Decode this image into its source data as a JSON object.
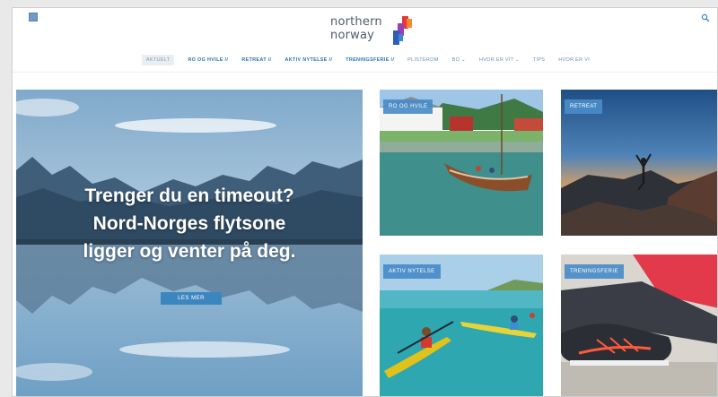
{
  "header": {
    "logo_line1": "northern",
    "logo_line2": "norway"
  },
  "nav": {
    "items": [
      {
        "label": "AKTUELT",
        "style": "active"
      },
      {
        "label": "RO OG HVILE //",
        "style": "bold"
      },
      {
        "label": "RETREAT //",
        "style": "bold"
      },
      {
        "label": "AKTIV NYTELSE //",
        "style": "bold"
      },
      {
        "label": "TRENINGSFERIE //",
        "style": "bold"
      },
      {
        "label": "PLISTEROM",
        "style": "light"
      },
      {
        "label": "BO ⌄",
        "style": "light"
      },
      {
        "label": "HVOR ER VI? ⌄",
        "style": "light"
      },
      {
        "label": "TIPS",
        "style": "light"
      },
      {
        "label": "HVOR ER VI",
        "style": "light"
      }
    ]
  },
  "hero": {
    "line1": "Trenger du en timeout?",
    "line2": "Nord-Norges flytsone",
    "line3": "ligger og venter på deg.",
    "button": "LES MER"
  },
  "tiles": {
    "ro": "RO OG HVILE",
    "retreat": "RETREAT",
    "aktiv": "AKTIV NYTELSE",
    "trening": "TRENINGSFERIE"
  },
  "colors": {
    "brand_blue": "#2d76b3",
    "label_blue": "#4a8cc8",
    "button_blue": "#3c86c0"
  },
  "icons": {
    "top_left": "app-square-icon",
    "top_right": "search-icon"
  }
}
